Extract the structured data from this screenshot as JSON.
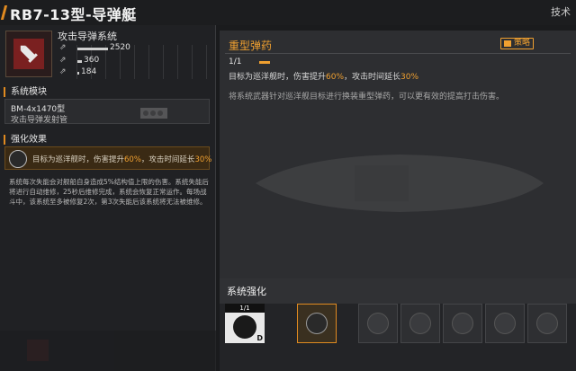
{
  "header": {
    "title": "RB7-13型-导弹艇",
    "top_right": "技术"
  },
  "system": {
    "name": "攻击导弹系统",
    "stats": [
      {
        "icon": "attack-icon",
        "value": "2520",
        "fill": 0.8
      },
      {
        "icon": "cooldown-icon",
        "value": "360",
        "fill": 0.12
      },
      {
        "icon": "range-icon",
        "value": "184",
        "fill": 0.04
      }
    ]
  },
  "module": {
    "heading": "系统模块",
    "name": "BM-4x1470型",
    "desc": "攻击导弹发射管"
  },
  "enhance_effect": {
    "heading": "强化效果",
    "text_a": "目标为巡洋舰时，伤害提升",
    "val_a": "60%",
    "text_b": "，攻击时间延长",
    "val_b": "30%"
  },
  "left_desc": "系统每次失能会对舰船自身造成5%结构值上限的伤害。系统失能后将进行自动维修，25秒后维修完成，系统会恢复正常运作。每场战斗中，该系统至多被修复2次，第3次失能后该系统将无法被维修。",
  "ammo": {
    "title": "重型弹药",
    "strategy": "策略",
    "level": "1/1",
    "effect_a": "目标为巡洋舰时，伤害提升",
    "val_a": "60%",
    "effect_b": "，攻击时间延长",
    "val_b": "30%",
    "desc": "将系统武器针对巡洋舰目标进行换装重型弹药，可以更有效的提高打击伤害。"
  },
  "enhance": {
    "title": "系统强化",
    "base_level": "1/1",
    "base_tag": "D",
    "slots": [
      "heavy-ammo-icon",
      "missile-icon",
      "missile-icon",
      "module-icon",
      "bomb-icon",
      "missile-icon",
      "burst-icon",
      "missile-icon"
    ]
  },
  "colors": {
    "accent": "#f0a030",
    "panel": "#2d2e31"
  }
}
